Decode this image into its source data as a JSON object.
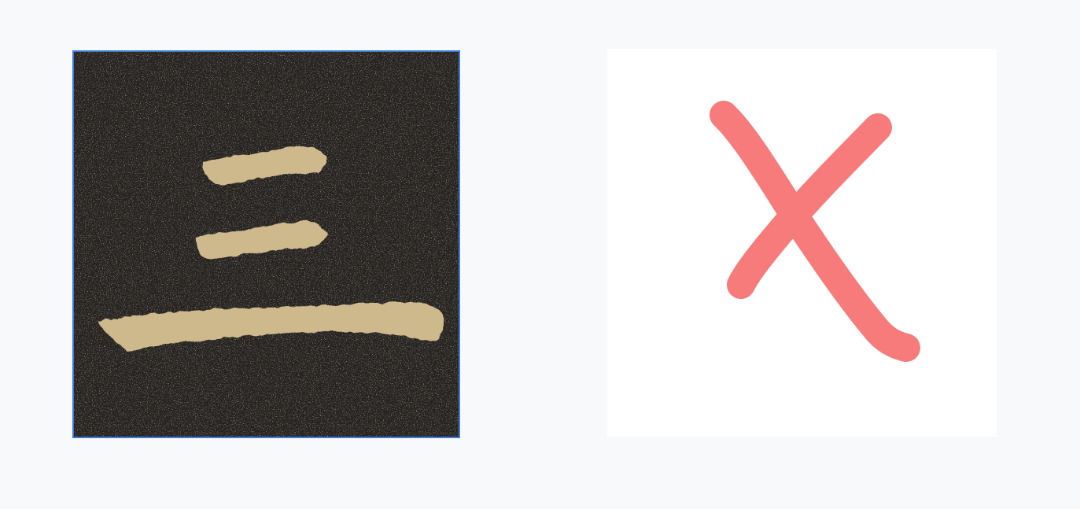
{
  "options": [
    {
      "id": "character-image",
      "kind": "calligraphy-rubbing",
      "selected": true
    },
    {
      "id": "answer-drawing",
      "kind": "handwritten-mark",
      "icon": "cross-mark-icon"
    }
  ],
  "colors": {
    "page_background": "#f8f9fb",
    "selection_border": "#3a7bd5",
    "stone": "#262320",
    "ink_reversed": "#cdb98c",
    "cross_mark": "#f77b7b",
    "card_background": "#ffffff"
  }
}
